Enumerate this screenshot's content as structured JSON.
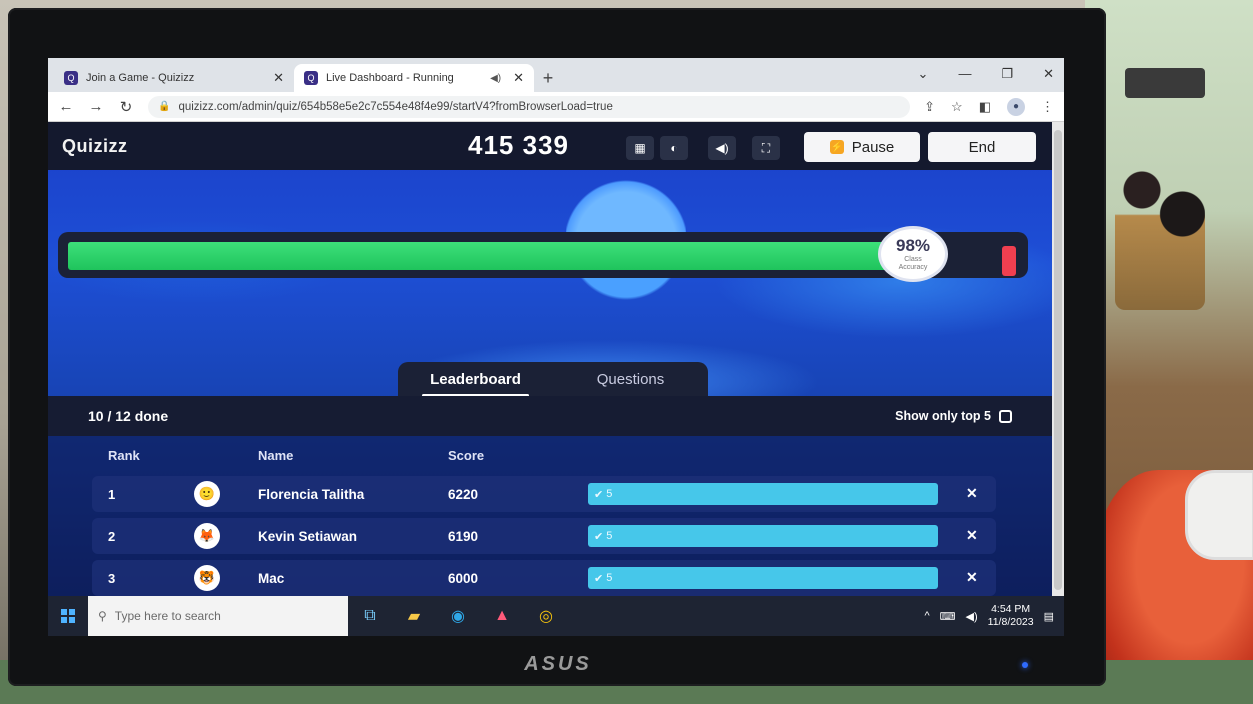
{
  "browser": {
    "tabs": [
      {
        "label": "Join a Game - Quizizz",
        "active": false
      },
      {
        "label": "Live Dashboard - Running",
        "active": true
      }
    ],
    "new_tab": "+",
    "url": "quizizz.com/admin/quiz/654b58e5e2c7c554e48f4e99/startV4?fromBrowserLoad=true"
  },
  "app": {
    "logo": "Quizizz",
    "game_code": "415 339",
    "pause_label": "Pause",
    "end_label": "End"
  },
  "progress": {
    "correct_fraction": 0.89,
    "accuracy": "98%",
    "accuracy_caption_1": "Class",
    "accuracy_caption_2": "Accuracy",
    "correct_color": "#22cc63",
    "incorrect_color": "#f03f50"
  },
  "tabs": {
    "leaderboard": "Leaderboard",
    "questions": "Questions"
  },
  "board": {
    "done": "10 / 12 done",
    "show_top5": "Show only top 5",
    "columns": {
      "rank": "Rank",
      "name": "Name",
      "score": "Score"
    },
    "rows": [
      {
        "rank": "1",
        "name": "Florencia Talitha",
        "score": "6220",
        "correct": "5",
        "avatar": "🙂"
      },
      {
        "rank": "2",
        "name": "Kevin Setiawan",
        "score": "6190",
        "correct": "5",
        "avatar": "🦊"
      },
      {
        "rank": "3",
        "name": "Mac",
        "score": "6000",
        "correct": "5",
        "avatar": "🐯"
      }
    ]
  },
  "taskbar": {
    "search_placeholder": "Type here to search",
    "time": "4:54 PM",
    "date": "11/8/2023"
  },
  "monitor": {
    "brand": "ASUS"
  }
}
